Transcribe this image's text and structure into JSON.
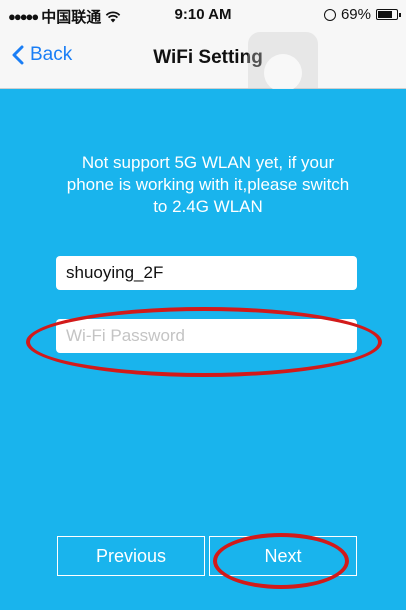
{
  "status_bar": {
    "signal": "●●●●●",
    "carrier": "中国联通",
    "time": "9:10 AM",
    "battery_percent": "69%",
    "battery_level": 0.69
  },
  "nav": {
    "back_label": "Back",
    "title": "WiFi Setting"
  },
  "main": {
    "notice": "Not support 5G WLAN yet, if your phone is working with it,please switch to 2.4G WLAN",
    "ssid_value": "shuoying_2F",
    "password_placeholder": "Wi-Fi Password",
    "previous_label": "Previous",
    "next_label": "Next"
  },
  "colors": {
    "background": "#19b4ed",
    "accent": "#1a7ef5",
    "annotation": "#d21a1a"
  }
}
